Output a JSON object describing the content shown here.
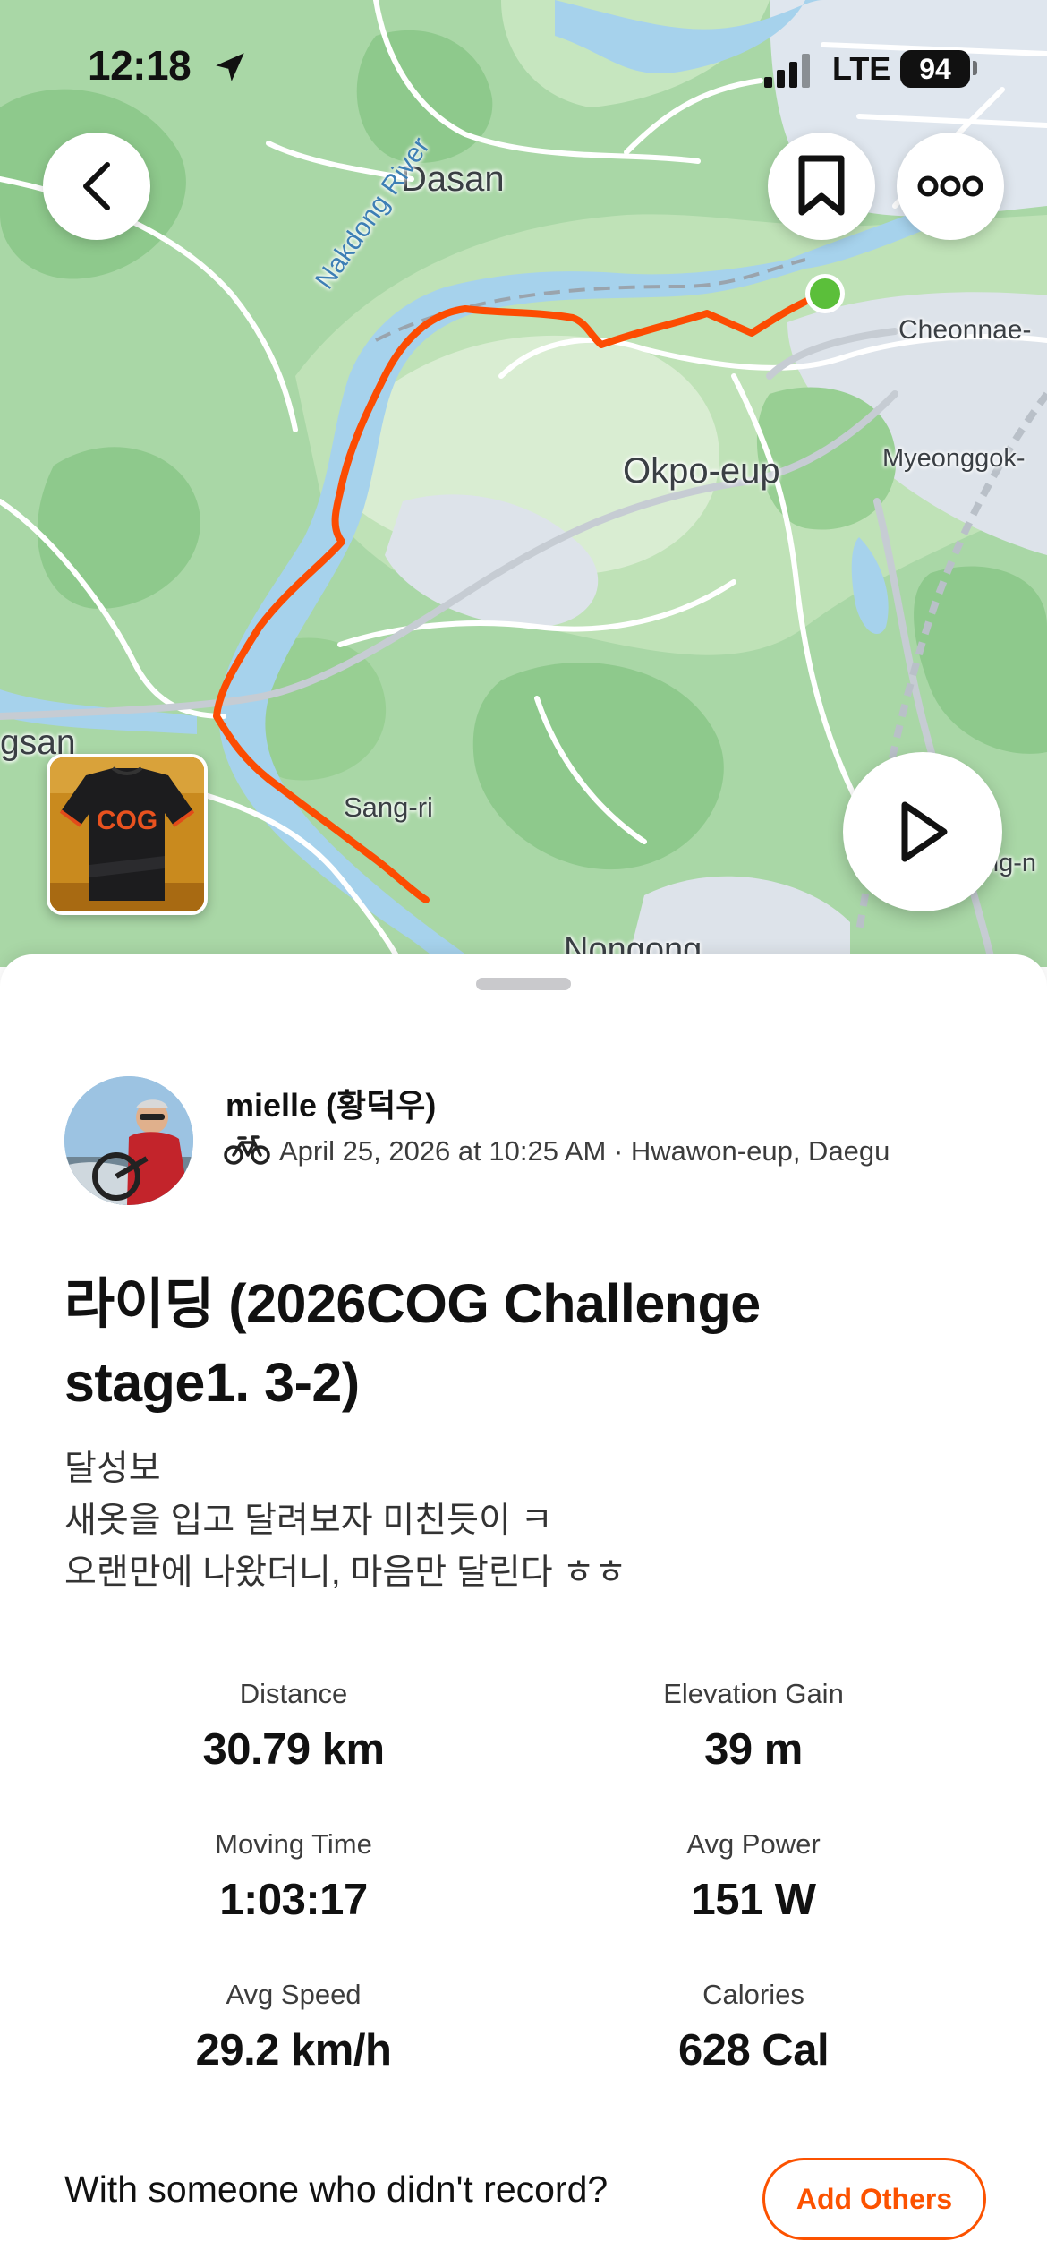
{
  "status_bar": {
    "time": "12:18",
    "network": "LTE",
    "battery": "94"
  },
  "map": {
    "labels": {
      "dasan": "Dasan",
      "river": "Nakdong River",
      "cheonnae": "Cheonnae-",
      "okpo": "Okpo-eup",
      "myeonggok": "Myeonggok-",
      "gsan": "gsan",
      "sangri": "Sang-ri",
      "nongong": "Nongong",
      "ng": "ng-n"
    },
    "route_color": "#fc4c02",
    "start_marker_color": "#5bbf3a"
  },
  "photo": {
    "jersey_text": "COG"
  },
  "activity": {
    "athlete_name": "mielle (황덕우)",
    "activity_icon": "bike-icon",
    "meta": "April 25, 2026 at 10:25 AM · Hwawon-eup, Daegu",
    "title_line1": "라이딩 (2026COG Challenge",
    "title_line2": "stage1. 3-2)",
    "description": [
      "달성보",
      "새옷을 입고 달려보자 미친듯이 ㅋ",
      "오랜만에 나왔더니, 마음만 달린다 ㅎㅎ"
    ]
  },
  "stats": [
    {
      "label": "Distance",
      "value": "30.79 km"
    },
    {
      "label": "Elevation Gain",
      "value": "39 m"
    },
    {
      "label": "Moving Time",
      "value": "1:03:17"
    },
    {
      "label": "Avg Power",
      "value": "151 W"
    },
    {
      "label": "Avg Speed",
      "value": "29.2 km/h"
    },
    {
      "label": "Calories",
      "value": "628 Cal"
    }
  ],
  "footer": {
    "prompt": "With someone who didn't record?",
    "add_others_label": "Add Others"
  },
  "colors": {
    "accent": "#fc5200",
    "map_green": "#a9d7a6",
    "river": "#a6d2ec"
  }
}
